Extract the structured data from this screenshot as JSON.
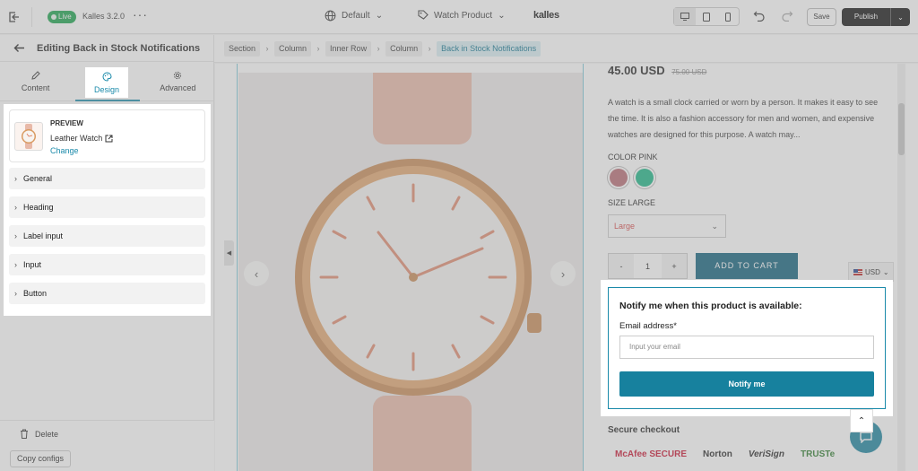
{
  "topbar": {
    "live_label": "Live",
    "theme_name": "Kalles 3.2.0",
    "more_label": "···",
    "page_select": "Default",
    "product_select": "Watch Product",
    "brand": "kalles",
    "save_label": "Save",
    "publish_label": "Publish"
  },
  "panel": {
    "title": "Editing Back in Stock Notifications",
    "tabs": [
      {
        "label": "Content",
        "icon": "pencil-icon"
      },
      {
        "label": "Design",
        "icon": "palette-icon"
      },
      {
        "label": "Advanced",
        "icon": "gear-icon"
      }
    ],
    "preview": {
      "label": "PREVIEW",
      "product_name": "Leather Watch",
      "change_label": "Change"
    },
    "sections": [
      "General",
      "Heading",
      "Label input",
      "Input",
      "Button"
    ],
    "delete_label": "Delete",
    "copy_label": "Copy configs"
  },
  "breadcrumb": [
    "Section",
    "Column",
    "Inner Row",
    "Column",
    "Back in Stock Notifications"
  ],
  "product": {
    "price": "45.00 USD",
    "compare_price": "75.00 USD",
    "description": "A watch is a small clock carried or worn by a person. It makes it easy to see the time. It is also a fashion accessory for men and women, and expensive watches are designed for this purpose. A watch may...",
    "color_label": "COLOR PINK",
    "swatch_colors": [
      "#b76a72",
      "#19b585"
    ],
    "size_label": "SIZE LARGE",
    "size_value": "Large",
    "quantity": "1",
    "qty_minus": "-",
    "qty_plus": "+",
    "add_to_cart": "ADD TO CART",
    "currency": "USD",
    "secure_checkout": "Secure checkout",
    "trust_logos": [
      "McAfee SECURE",
      "Norton",
      "VeriSign",
      "TRUSTe"
    ]
  },
  "notify": {
    "title": "Notify me when this product is available:",
    "email_label": "Email address*",
    "email_placeholder": "Input your email",
    "button_label": "Notify me"
  },
  "colors": {
    "accent": "#1a8aaa",
    "cart_button": "#0d5f7a",
    "live": "#17a34a"
  }
}
